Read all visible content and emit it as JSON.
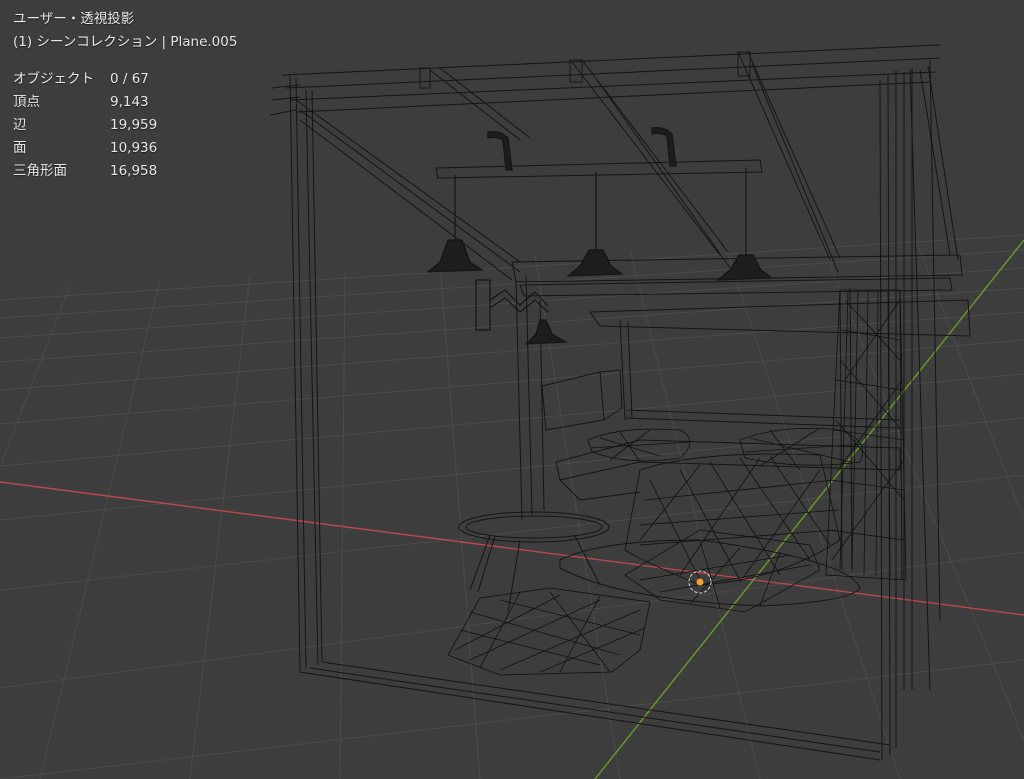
{
  "viewport": {
    "view_label": "ユーザー・透視投影",
    "collection_label": "(1) シーンコレクション | Plane.005",
    "background_color": "#3d3d3d",
    "grid_color": "#4b4b4b",
    "x_axis_color": "#b8484e",
    "y_axis_color": "#6a9a2a",
    "origin_marker_color": "#f0a030"
  },
  "stats": [
    {
      "label": "オブジェクト",
      "value": "0 / 67"
    },
    {
      "label": "頂点",
      "value": "9,143"
    },
    {
      "label": "辺",
      "value": "19,959"
    },
    {
      "label": "面",
      "value": "10,936"
    },
    {
      "label": "三角形面",
      "value": "16,958"
    }
  ]
}
